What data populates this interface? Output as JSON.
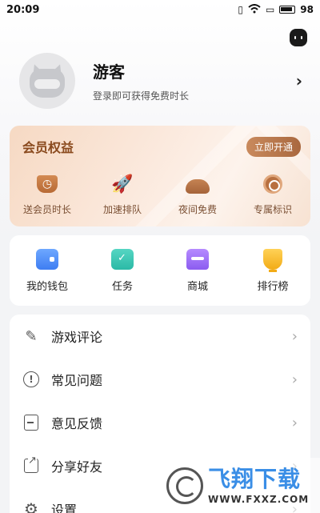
{
  "status_bar": {
    "time": "20:09",
    "battery": "98"
  },
  "profile": {
    "name": "游客",
    "subtitle": "登录即可获得免费时长"
  },
  "vip": {
    "title": "会员权益",
    "open_button": "立即开通",
    "items": [
      {
        "label": "送会员时长",
        "icon": "clock-tag-icon"
      },
      {
        "label": "加速排队",
        "icon": "rocket-icon"
      },
      {
        "label": "夜间免费",
        "icon": "moon-icon"
      },
      {
        "label": "专属标识",
        "icon": "medal-icon"
      }
    ]
  },
  "tools": [
    {
      "label": "我的钱包",
      "icon": "wallet-icon"
    },
    {
      "label": "任务",
      "icon": "task-icon"
    },
    {
      "label": "商城",
      "icon": "shop-icon"
    },
    {
      "label": "排行榜",
      "icon": "trophy-icon"
    }
  ],
  "menu": [
    {
      "label": "游戏评论",
      "icon": "pencil-icon"
    },
    {
      "label": "常见问题",
      "icon": "question-icon"
    },
    {
      "label": "意见反馈",
      "icon": "feedback-icon"
    },
    {
      "label": "分享好友",
      "icon": "share-icon"
    },
    {
      "label": "设置",
      "icon": "gear-icon"
    }
  ],
  "watermark": {
    "title": "飞翔下载",
    "url": "WWW.FXXZ.COM"
  }
}
